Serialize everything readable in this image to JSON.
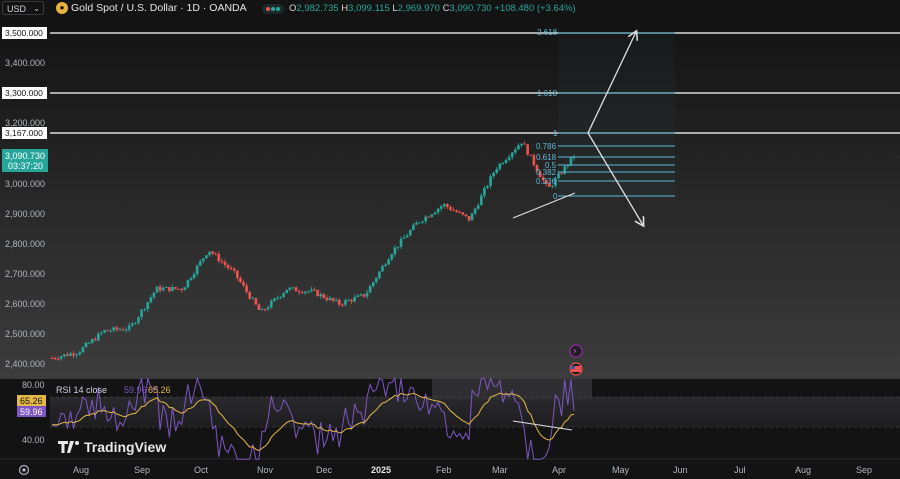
{
  "topbar": {
    "currency": "USD",
    "symbol_title": "Gold Spot / U.S. Dollar · 1D · OANDA",
    "ohlc": {
      "o_label": "O",
      "o": "2,982.735",
      "h_label": "H",
      "h": "3,099.115",
      "l_label": "L",
      "l": "2,969.970",
      "c_label": "C",
      "c": "3,090.730",
      "change": "+108.480 (+3.64%)"
    }
  },
  "price_axis": {
    "labels": [
      "3,500.000",
      "3,400.000",
      "3,300.000",
      "3,200.000",
      "3,167.000",
      "3,000.000",
      "2,900.000",
      "2,800.000",
      "2,700.000",
      "2,600.000",
      "2,500.000",
      "2,400.000"
    ],
    "last_price": "3,090.730",
    "countdown": "03:37:20"
  },
  "time_axis": {
    "labels": [
      "Aug",
      "Sep",
      "Oct",
      "Nov",
      "Dec",
      "2025",
      "Feb",
      "Mar",
      "Apr",
      "May",
      "Jun",
      "Jul",
      "Aug",
      "Sep"
    ]
  },
  "fib_levels": [
    "2.618",
    "1.618",
    "1",
    "0.786",
    "0.618",
    "0.5",
    "0.382",
    "0.236",
    "0"
  ],
  "rsi": {
    "title": "RSI 14 close",
    "value1": "59.96",
    "value2": "65.26",
    "levels": [
      "80.00",
      "40.00"
    ]
  },
  "watermark": "TradingView",
  "colors": {
    "up": "#26a69a",
    "down": "#ef5350",
    "fib": "#5cb8d6",
    "rsi": "#7e57c2",
    "rsi_ma": "#e6b845",
    "last": "#26a69a"
  },
  "chart_data": {
    "type": "candlestick",
    "title": "Gold Spot / U.S. Dollar · 1D · OANDA",
    "ylim": [
      2380,
      3560
    ],
    "x_range": [
      "Jul 2024",
      "Sep 2025"
    ],
    "close_series_approx": [
      {
        "x": "Jul",
        "y": 2420
      },
      {
        "x": "Aug",
        "y": 2440
      },
      {
        "x": "Aug-late",
        "y": 2510
      },
      {
        "x": "Sep",
        "y": 2520
      },
      {
        "x": "Sep-late",
        "y": 2650
      },
      {
        "x": "Oct",
        "y": 2650
      },
      {
        "x": "Oct-late",
        "y": 2780
      },
      {
        "x": "Nov",
        "y": 2700
      },
      {
        "x": "Nov-mid",
        "y": 2570
      },
      {
        "x": "Nov-late",
        "y": 2650
      },
      {
        "x": "Dec",
        "y": 2640
      },
      {
        "x": "Dec-mid",
        "y": 2600
      },
      {
        "x": "2025",
        "y": 2630
      },
      {
        "x": "Jan-late",
        "y": 2770
      },
      {
        "x": "Feb",
        "y": 2870
      },
      {
        "x": "Feb-late",
        "y": 2930
      },
      {
        "x": "Mar",
        "y": 2880
      },
      {
        "x": "Mar-late",
        "y": 3050
      },
      {
        "x": "Apr",
        "y": 3140
      },
      {
        "x": "Apr-8",
        "y": 2980
      },
      {
        "x": "Apr-9",
        "y": 3090.73
      }
    ],
    "horizontal_levels": [
      3500,
      3300,
      3167
    ],
    "fib_retracement": {
      "0": 2956,
      "0.236": 3005,
      "0.382": 3034,
      "0.5": 3058,
      "0.618": 3082,
      "0.786": 3117,
      "1": 3162,
      "1.618": 3294,
      "2.618": 3502
    }
  }
}
